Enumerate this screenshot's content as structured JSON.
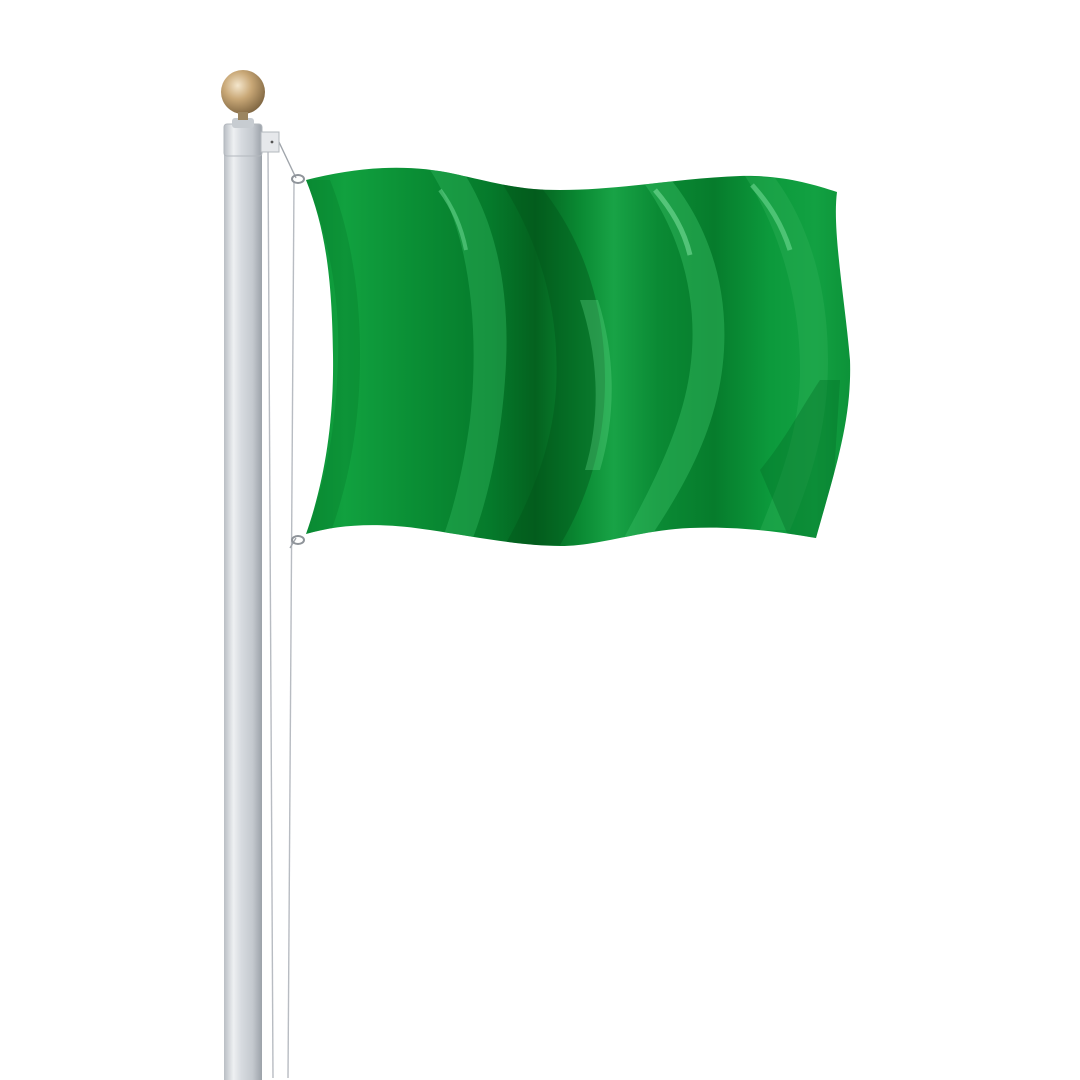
{
  "scene": {
    "subject": "flag-on-flagpole",
    "background_color": "#ffffff",
    "flag": {
      "base_color": "#0a8f35",
      "dark_fold_color": "#04621f",
      "highlight_color": "#3bbf63"
    },
    "pole": {
      "color": "#d9dde2",
      "shade_color": "#aab0b7"
    },
    "finial": {
      "color": "#c9a877"
    }
  }
}
